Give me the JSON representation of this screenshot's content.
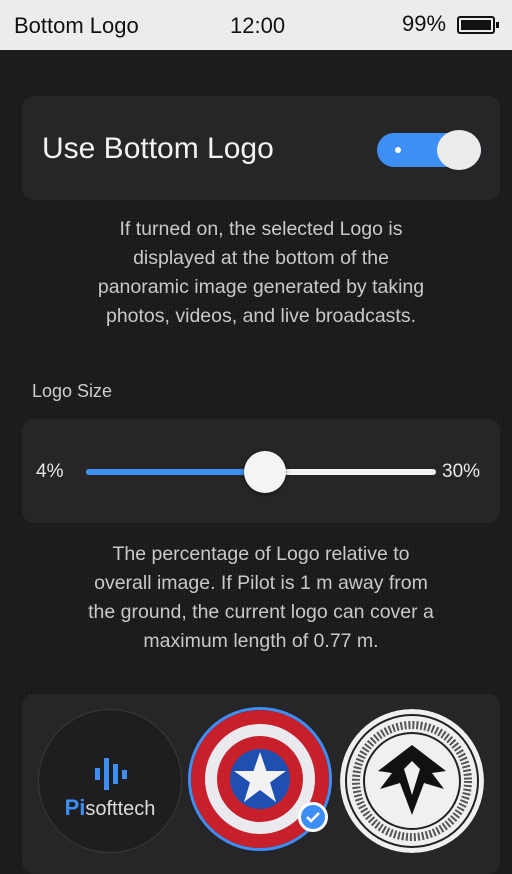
{
  "status_bar": {
    "title": "Bottom Logo",
    "time": "12:00",
    "battery": "99%"
  },
  "toggle": {
    "label": "Use Bottom Logo",
    "on": true
  },
  "toggle_description": {
    "line1": "If turned on, the selected Logo is",
    "line2": "displayed at the bottom of the",
    "line3": "panoramic image generated by taking",
    "line4": "photos, videos, and live broadcasts."
  },
  "logo_size": {
    "label": "Logo Size",
    "min_label": "4%",
    "max_label": "30%",
    "value_fraction": 0.51
  },
  "size_description": {
    "line1": "The percentage of Logo relative to",
    "line2": "overall image. If Pilot is 1 m away from",
    "line3": "the ground, the current logo can cover a",
    "line4": "maximum length of 0.77 m."
  },
  "logos": {
    "pisofttech": {
      "pi": "Pi",
      "rest": "softtech"
    },
    "selected": "shield-star-logo"
  },
  "colors": {
    "accent": "#3d8ef5",
    "background": "#1a1a1b",
    "card": "#262628"
  }
}
